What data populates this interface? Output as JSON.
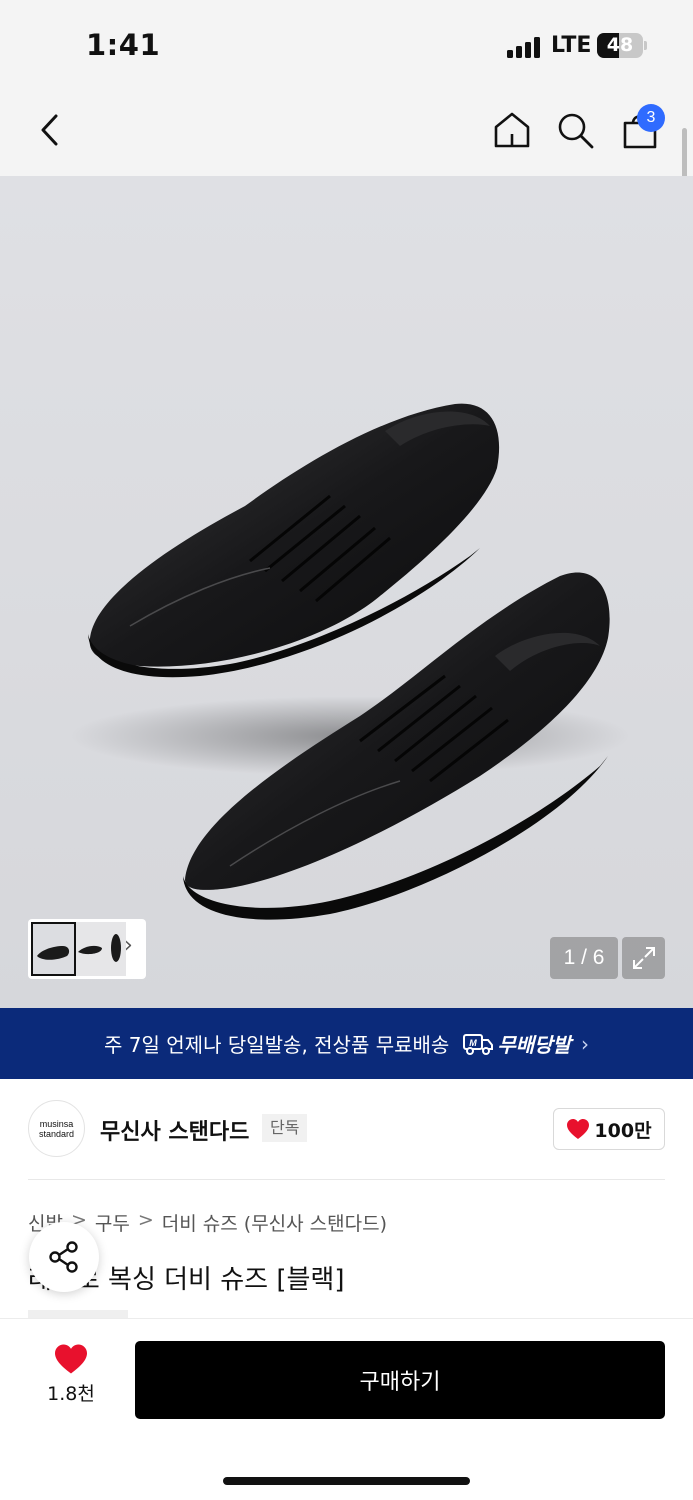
{
  "status_bar": {
    "time": "1:41",
    "network": "LTE",
    "battery": "48",
    "battery_level_percent": 48
  },
  "nav": {
    "back_icon": "chevron-left-icon",
    "home_icon": "home-icon",
    "search_icon": "search-icon",
    "bag_icon": "shopping-bag-icon",
    "bag_badge": "3"
  },
  "gallery": {
    "page_indicator": "1 / 6",
    "thumbnail_chevron": "›",
    "expand_icon": "expand-icon"
  },
  "promo": {
    "text": "주 7일 언제나 당일발송, 전상품 무료배송",
    "badge_icon": "delivery-truck-icon",
    "badge_text": "무배당발",
    "arrow": "›"
  },
  "brand": {
    "logo_line1": "musinsa",
    "logo_line2": "standard",
    "name": "무신사 스탠다드",
    "exclusive_tag": "단독",
    "like_count": "100만"
  },
  "breadcrumb": [
    "신발",
    "구두",
    "더비 슈즈 (무신사 스탠다드)"
  ],
  "breadcrumb_separator": ">",
  "product": {
    "title": "레트로 복싱 더비 슈즈 [블랙]"
  },
  "bottom_bar": {
    "wish_count": "1.8천",
    "buy_label": "구매하기"
  },
  "colors": {
    "promo_background": "#0b2a7a",
    "badge_blue": "#2f6bff",
    "heart_red": "#e8112d",
    "buy_button": "#000000"
  }
}
